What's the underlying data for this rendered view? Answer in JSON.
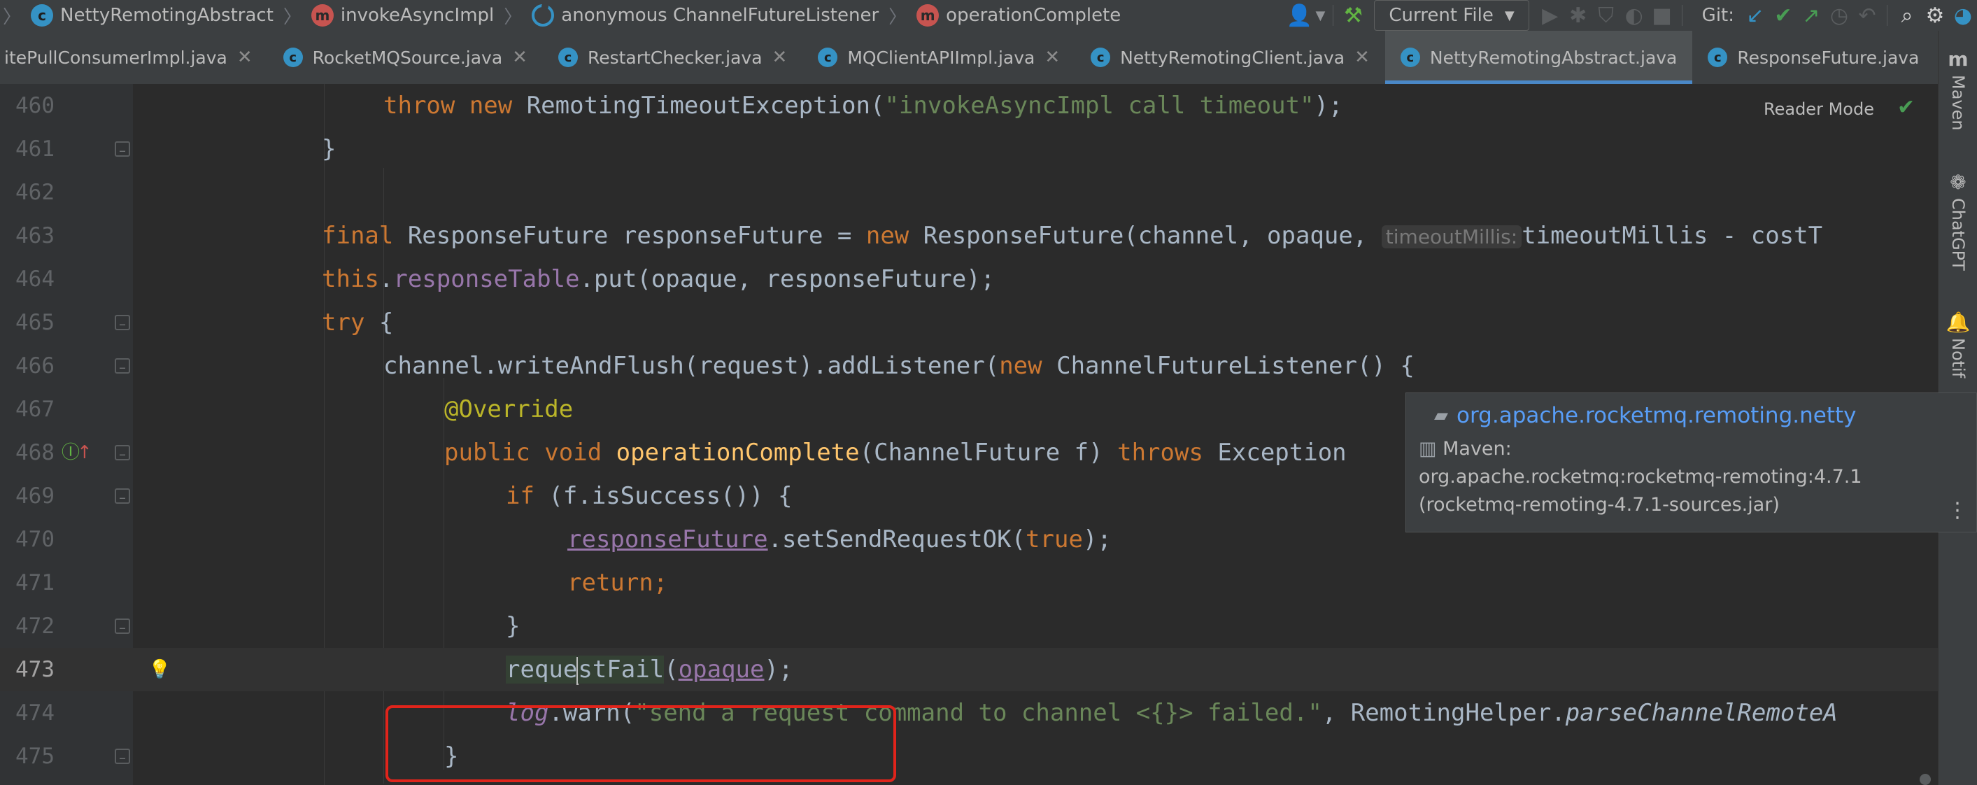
{
  "navbar": {
    "crumbs": [
      {
        "label": "NettyRemotingAbstract",
        "icon": "class-icon"
      },
      {
        "label": "invokeAsyncImpl",
        "icon": "method-icon"
      },
      {
        "label": "anonymous ChannelFutureListener",
        "icon": "anonymous-class-icon"
      },
      {
        "label": "operationComplete",
        "icon": "method-icon"
      }
    ],
    "run_config": "Current File",
    "git_label": "Git:"
  },
  "tabs": [
    {
      "label": "itePullConsumerImpl.java",
      "active": false
    },
    {
      "label": "RocketMQSource.java",
      "active": false
    },
    {
      "label": "RestartChecker.java",
      "active": false
    },
    {
      "label": "MQClientAPIImpl.java",
      "active": false
    },
    {
      "label": "NettyRemotingClient.java",
      "active": false
    },
    {
      "label": "NettyRemotingAbstract.java",
      "active": true
    },
    {
      "label": "ResponseFuture.java",
      "active": false
    }
  ],
  "right_strip": {
    "maven": "Maven",
    "chatgpt": "ChatGPT",
    "notifications": "Notif"
  },
  "editor": {
    "reader_mode": "Reader Mode",
    "lines": [
      "460",
      "461",
      "462",
      "463",
      "464",
      "465",
      "466",
      "467",
      "468",
      "469",
      "470",
      "471",
      "472",
      "473",
      "474",
      "475"
    ],
    "code": {
      "l460_a": "throw new ",
      "l460_b": "RemotingTimeoutException(",
      "l460_c": "\"invokeAsyncImpl call timeout\"",
      "l460_d": ");",
      "l461": "}",
      "l463_a": "final ",
      "l463_b": "ResponseFuture responseFuture = ",
      "l463_c": "new ",
      "l463_d": "ResponseFuture(channel, opaque, ",
      "l463_hint": "timeoutMillis:",
      "l463_e": "timeoutMillis - costT",
      "l464_a": "this",
      "l464_b": ".",
      "l464_c": "responseTable",
      "l464_d": ".put(opaque, responseFuture);",
      "l465_a": "try ",
      "l465_b": "{",
      "l466_a": "channel.writeAndFlush(request).addListener(",
      "l466_b": "new ",
      "l466_c": "ChannelFutureListener() {",
      "l467": "@Override",
      "l468_a": "public void ",
      "l468_b": "operationComplete",
      "l468_c": "(ChannelFuture f) ",
      "l468_d": "throws ",
      "l468_e": "Exception",
      "l469_a": "if ",
      "l469_b": "(f.isSuccess()) {",
      "l470_a": "responseFuture",
      "l470_b": ".setSendRequestOK(",
      "l470_c": "true",
      "l470_d": ");",
      "l471": "return;",
      "l472": "}",
      "l473_a": "reque",
      "l473_b": "stFail",
      "l473_c": "(",
      "l473_d": "opaque",
      "l473_e": ");",
      "l474_a": "log",
      "l474_b": ".warn(",
      "l474_c": "\"send a request command to channel <{}> failed.\"",
      "l474_d": ", RemotingHelper.",
      "l474_e": "parseChannelRemoteA",
      "l475": "}"
    }
  },
  "popup": {
    "package": "org.apache.rocketmq.remoting.netty",
    "maven_label": "Maven:",
    "artifact": "org.apache.rocketmq:rocketmq-remoting:4.7.1",
    "jar": "(rocketmq-remoting-4.7.1-sources.jar)"
  },
  "colors": {
    "keyword": "#cc7832",
    "string": "#6a8759",
    "field": "#9876aa",
    "method": "#ffc66d",
    "annotation": "#bbb529",
    "highlight_box": "#e0241b",
    "link": "#589df6"
  }
}
